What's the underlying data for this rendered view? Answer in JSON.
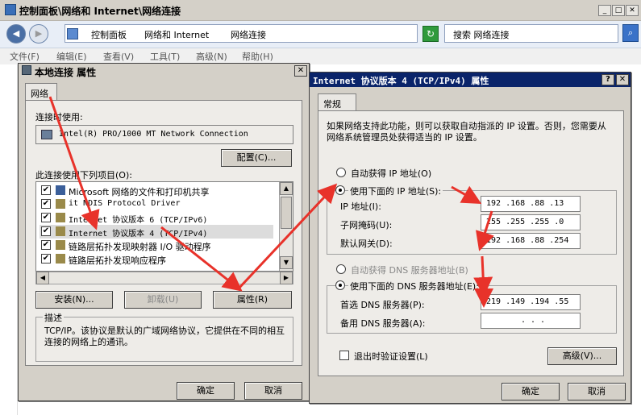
{
  "explorer": {
    "title": "控制面板\\网络和 Internet\\网络连接",
    "breadcrumb": [
      "控制面板",
      "网络和 Internet",
      "网络连接"
    ],
    "search_placeholder": "搜索 网络连接",
    "menu": [
      "文件(F)",
      "编辑(E)",
      "查看(V)",
      "工具(T)",
      "高级(N)",
      "帮助(H)"
    ]
  },
  "props_dialog": {
    "title": "本地连接 属性",
    "tab": "网络",
    "connect_using_label": "连接时使用:",
    "adapter": "Intel(R) PRO/1000 MT Network Connection",
    "configure_button": "配置(C)...",
    "items_label": "此连接使用下列项目(O):",
    "items": [
      {
        "label": "Microsoft 网络的文件和打印机共享",
        "checked": true
      },
      {
        "label": "it NDIS Protocol Driver",
        "checked": true
      },
      {
        "label": "Internet 协议版本 6 (TCP/IPv6)",
        "checked": true
      },
      {
        "label": "Internet 协议版本 4 (TCP/IPv4)",
        "checked": true
      },
      {
        "label": "链路层拓扑发现映射器 I/O 驱动程序",
        "checked": true
      },
      {
        "label": "链路层拓扑发现响应程序",
        "checked": true
      }
    ],
    "install_button": "安装(N)...",
    "uninstall_button": "卸载(U)",
    "properties_button": "属性(R)",
    "description_label": "描述",
    "description": "TCP/IP。该协议是默认的广域网络协议，它提供在不同的相互连接的网络上的通讯。",
    "ok_button": "确定",
    "cancel_button": "取消"
  },
  "ipv4_dialog": {
    "title": "Internet 协议版本 4 (TCP/IPv4) 属性",
    "tab": "常规",
    "info_text": "如果网络支持此功能，则可以获取自动指派的 IP 设置。否则，您需要从网络系统管理员处获得适当的 IP 设置。",
    "auto_ip_label": "自动获得 IP 地址(O)",
    "manual_ip_label": "使用下面的 IP 地址(S):",
    "ip_label": "IP 地址(I):",
    "ip_value": "192 .168 .88 .13",
    "mask_label": "子网掩码(U):",
    "mask_value": "255 .255 .255 .0",
    "gateway_label": "默认网关(D):",
    "gateway_value": "192 .168 .88 .254",
    "auto_dns_label": "自动获得 DNS 服务器地址(B)",
    "manual_dns_label": "使用下面的 DNS 服务器地址(E):",
    "pref_dns_label": "首选 DNS 服务器(P):",
    "pref_dns_value": "219 .149 .194 .55",
    "alt_dns_label": "备用 DNS 服务器(A):",
    "alt_dns_value": ".    .    .",
    "validate_label": "退出时验证设置(L)",
    "advanced_button": "高级(V)...",
    "ok_button": "确定",
    "cancel_button": "取消"
  },
  "colors": {
    "arrow": "#e8322a",
    "title_active": "#0a246a"
  }
}
